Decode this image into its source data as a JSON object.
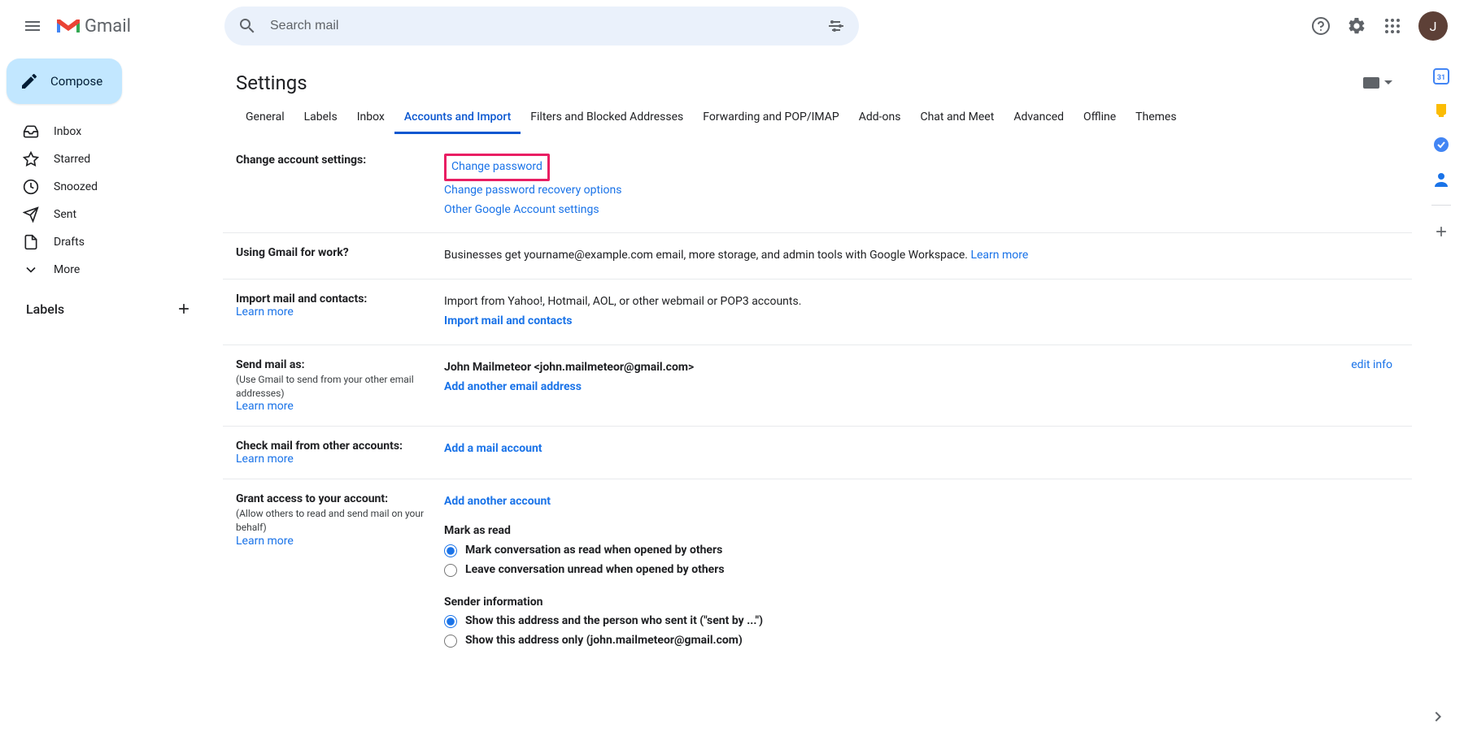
{
  "header": {
    "product": "Gmail",
    "search_placeholder": "Search mail",
    "avatar_initial": "J"
  },
  "sidebar": {
    "compose": "Compose",
    "items": [
      "Inbox",
      "Starred",
      "Snoozed",
      "Sent",
      "Drafts",
      "More"
    ],
    "labels_title": "Labels"
  },
  "settings": {
    "title": "Settings",
    "tabs": [
      "General",
      "Labels",
      "Inbox",
      "Accounts and Import",
      "Filters and Blocked Addresses",
      "Forwarding and POP/IMAP",
      "Add-ons",
      "Chat and Meet",
      "Advanced",
      "Offline",
      "Themes"
    ],
    "active_tab_index": 3
  },
  "sections": {
    "change_account": {
      "title": "Change account settings:",
      "change_password": "Change password",
      "recovery": "Change password recovery options",
      "other": "Other Google Account settings"
    },
    "work": {
      "title": "Using Gmail for work?",
      "text": "Businesses get yourname@example.com email, more storage, and admin tools with Google Workspace. ",
      "learn": "Learn more"
    },
    "import": {
      "title": "Import mail and contacts:",
      "learn": "Learn more",
      "text": "Import from Yahoo!, Hotmail, AOL, or other webmail or POP3 accounts.",
      "link": "Import mail and contacts"
    },
    "send_as": {
      "title": "Send mail as:",
      "sub": "(Use Gmail to send from your other email addresses)",
      "learn": "Learn more",
      "identity": "John Mailmeteor <john.mailmeteor@gmail.com>",
      "add": "Add another email address",
      "edit": "edit info"
    },
    "check_mail": {
      "title": "Check mail from other accounts:",
      "learn": "Learn more",
      "add": "Add a mail account"
    },
    "grant": {
      "title": "Grant access to your account:",
      "sub": "(Allow others to read and send mail on your behalf)",
      "learn": "Learn more",
      "add": "Add another account",
      "mark_title": "Mark as read",
      "mark_opt1": "Mark conversation as read when opened by others",
      "mark_opt2": "Leave conversation unread when opened by others",
      "sender_title": "Sender information",
      "sender_opt1": "Show this address and the person who sent it (\"sent by ...\")",
      "sender_opt2": "Show this address only (john.mailmeteor@gmail.com)"
    }
  }
}
